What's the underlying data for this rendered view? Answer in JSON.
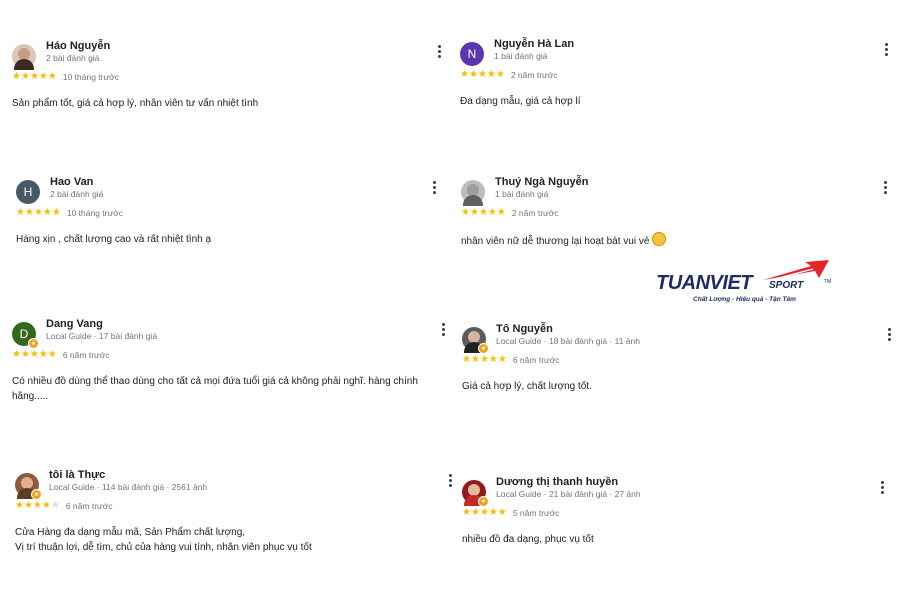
{
  "colors": {
    "star": "#fbbc04",
    "guide_badge": "#f0a21b",
    "logo_navy": "#1f2c64",
    "logo_red": "#e3262c"
  },
  "reviews": [
    {
      "name": "Háo Nguyễn",
      "meta": "2 bài đánh giá",
      "stars": 5,
      "date": "10 tháng trước",
      "text": "Sản phẩm tốt, giá cả hợp lý, nhân viên tư vấn nhiệt tình",
      "avatar_icon": "profile-photo",
      "avatar_letter": "",
      "avatar_color": "#6d4c3d"
    },
    {
      "name": "Nguyễn Hà Lan",
      "meta": "1 bài đánh giá",
      "stars": 5,
      "date": "2 năm trước",
      "text": "Đa dạng mẫu, giá cả hợp lí",
      "avatar_icon": "letter-avatar",
      "avatar_letter": "N",
      "avatar_color": "#5e35b1"
    },
    {
      "name": "Hao Van",
      "meta": "2 bài đánh giá",
      "stars": 5,
      "date": "10 tháng trước",
      "text": "Hàng xịn , chất lượng cao và rất nhiệt tình ạ",
      "avatar_icon": "letter-avatar",
      "avatar_letter": "H",
      "avatar_color": "#455a64"
    },
    {
      "name": "Thuý Ngà Nguyễn",
      "meta": "1 bài đánh giá",
      "stars": 5,
      "date": "2 năm trước",
      "text": "nhân viên nữ dễ thương lại hoạt bát vui vẻ",
      "avatar_icon": "profile-photo",
      "avatar_letter": "",
      "avatar_color": "#8a8a8a"
    },
    {
      "name": "Dang Vang",
      "meta": "Local Guide · 17 bài đánh giá",
      "stars": 5,
      "date": "6 năm trước",
      "text_lines": [
        "Có nhiều đồ dùng thể thao dùng cho tất cả mọi đứa tuổi giá cả không phải nghĩ. hàng chính",
        "hãng....."
      ],
      "avatar_icon": "letter-avatar",
      "avatar_letter": "D",
      "avatar_color": "#33691e"
    },
    {
      "name": "Tô Nguyễn",
      "meta": "Local Guide · 18 bài đánh giá · 11 ảnh",
      "stars": 5,
      "date": "6 năm trước",
      "text": "Giá cả hợp lý, chất lượng tốt.",
      "avatar_icon": "profile-photo",
      "avatar_letter": "",
      "avatar_color": "#3a3a3a"
    },
    {
      "name": "tôi là Thực",
      "meta": "Local Guide · 114 bài đánh giá · 2561 ảnh",
      "stars": 4,
      "date": "6 năm trước",
      "text_lines": [
        "Cửa Hàng đa dạng mẫu mã, Sản Phẩm chất lượng,",
        "Vị trí thuận lợi, dễ tìm, chủ của hàng vui tính, nhân viên phục vụ tốt"
      ],
      "avatar_icon": "profile-photo",
      "avatar_letter": "",
      "avatar_color": "#a0522d"
    },
    {
      "name": "Dương thị thanh huyền",
      "meta": "Local Guide · 21 bài đánh giá · 27 ảnh",
      "stars": 5,
      "date": "5 năm trước",
      "text": "nhiều đồ đa dạng, phục vụ tốt",
      "avatar_icon": "profile-photo",
      "avatar_letter": "",
      "avatar_color": "#b71c1c"
    }
  ],
  "logo": {
    "main": "TUANVIET",
    "sport": "SPORT",
    "tm": "TM",
    "tagline": "Chất Lượng - Hiệu quả - Tận Tâm"
  }
}
